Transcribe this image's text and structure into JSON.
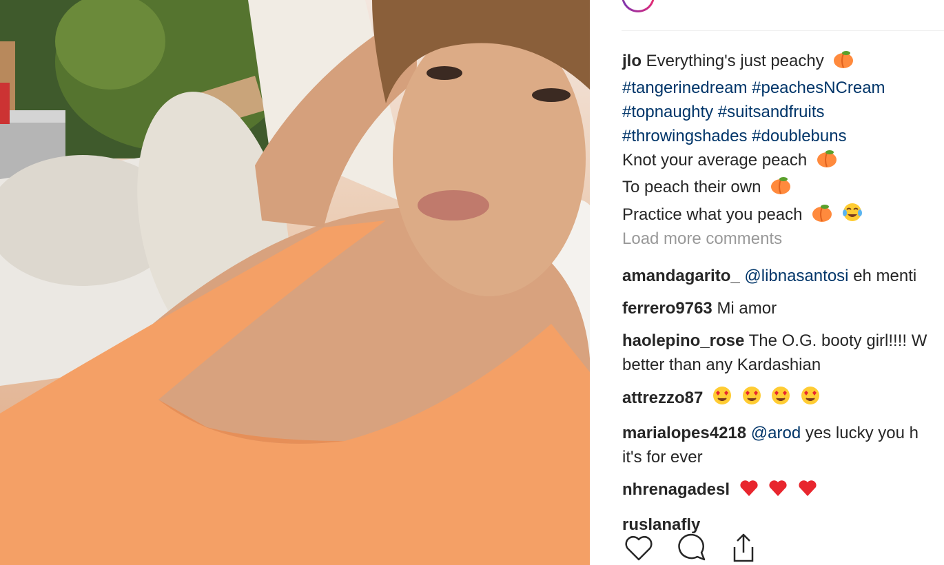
{
  "post": {
    "caption_user": "jlo",
    "caption_lines": [
      "Everything's just peachy",
      "#tangerinedream #peachesNCream",
      "#topnaughty #suitsandfruits",
      "#throwingshades #doublebuns",
      "Knot your average peach",
      "To peach their own",
      "Practice what you peach"
    ],
    "caption_emojis": [
      "peach-emoji",
      "tears-of-joy-emoji"
    ],
    "load_more": "Load more comments"
  },
  "comments": [
    {
      "user": "amandagarito_",
      "mention": "@libnasantosi",
      "text": "eh menti"
    },
    {
      "user": "ferrero9763",
      "text": "Mi amor"
    },
    {
      "user": "haolepino_rose",
      "text": "The O.G. booty girl!!!! W",
      "text2": "better than any Kardashian"
    },
    {
      "user": "attrezzo87",
      "emojis": [
        "heart-eyes-emoji",
        "heart-eyes-emoji",
        "heart-eyes-emoji",
        "heart-eyes-emoji"
      ]
    },
    {
      "user": "marialopes4218",
      "mention": "@arod",
      "text": "yes lucky you h",
      "text2": "it's for ever"
    },
    {
      "user": "nhrenagadesl",
      "emojis": [
        "red-heart-emoji",
        "red-heart-emoji",
        "red-heart-emoji"
      ]
    },
    {
      "user": "ruslanafly",
      "partial": true
    }
  ],
  "actions": {
    "icons": [
      "heart-icon",
      "comment-icon",
      "share-icon"
    ]
  },
  "colors": {
    "link": "#003569",
    "muted": "#999999",
    "text": "#262626",
    "swimsuit": "#f4a066"
  }
}
